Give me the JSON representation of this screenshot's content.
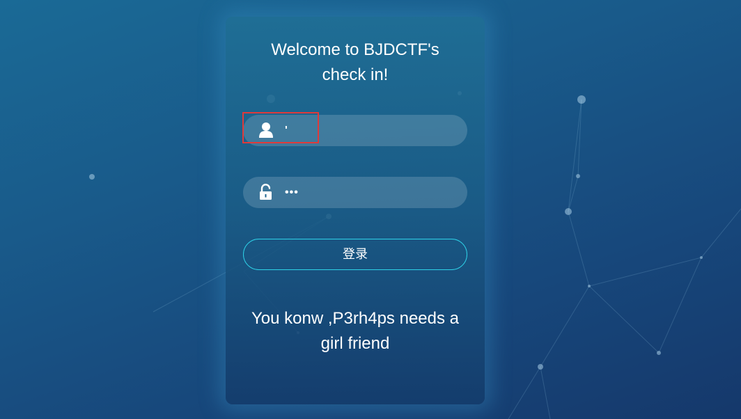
{
  "card": {
    "title_line1": "Welcome to BJDCTF's",
    "title_line2": "check in!"
  },
  "username_field": {
    "value": "'",
    "icon": "user-icon"
  },
  "password_field": {
    "value": "•••",
    "icon": "unlock-icon"
  },
  "login_button": {
    "label": "登录"
  },
  "message": {
    "line1": "You konw ,P3rh4ps needs a",
    "line2": "girl friend"
  },
  "colors": {
    "accent": "#2ed2e8",
    "highlight": "#e03a3a",
    "background": "#195a8a"
  }
}
